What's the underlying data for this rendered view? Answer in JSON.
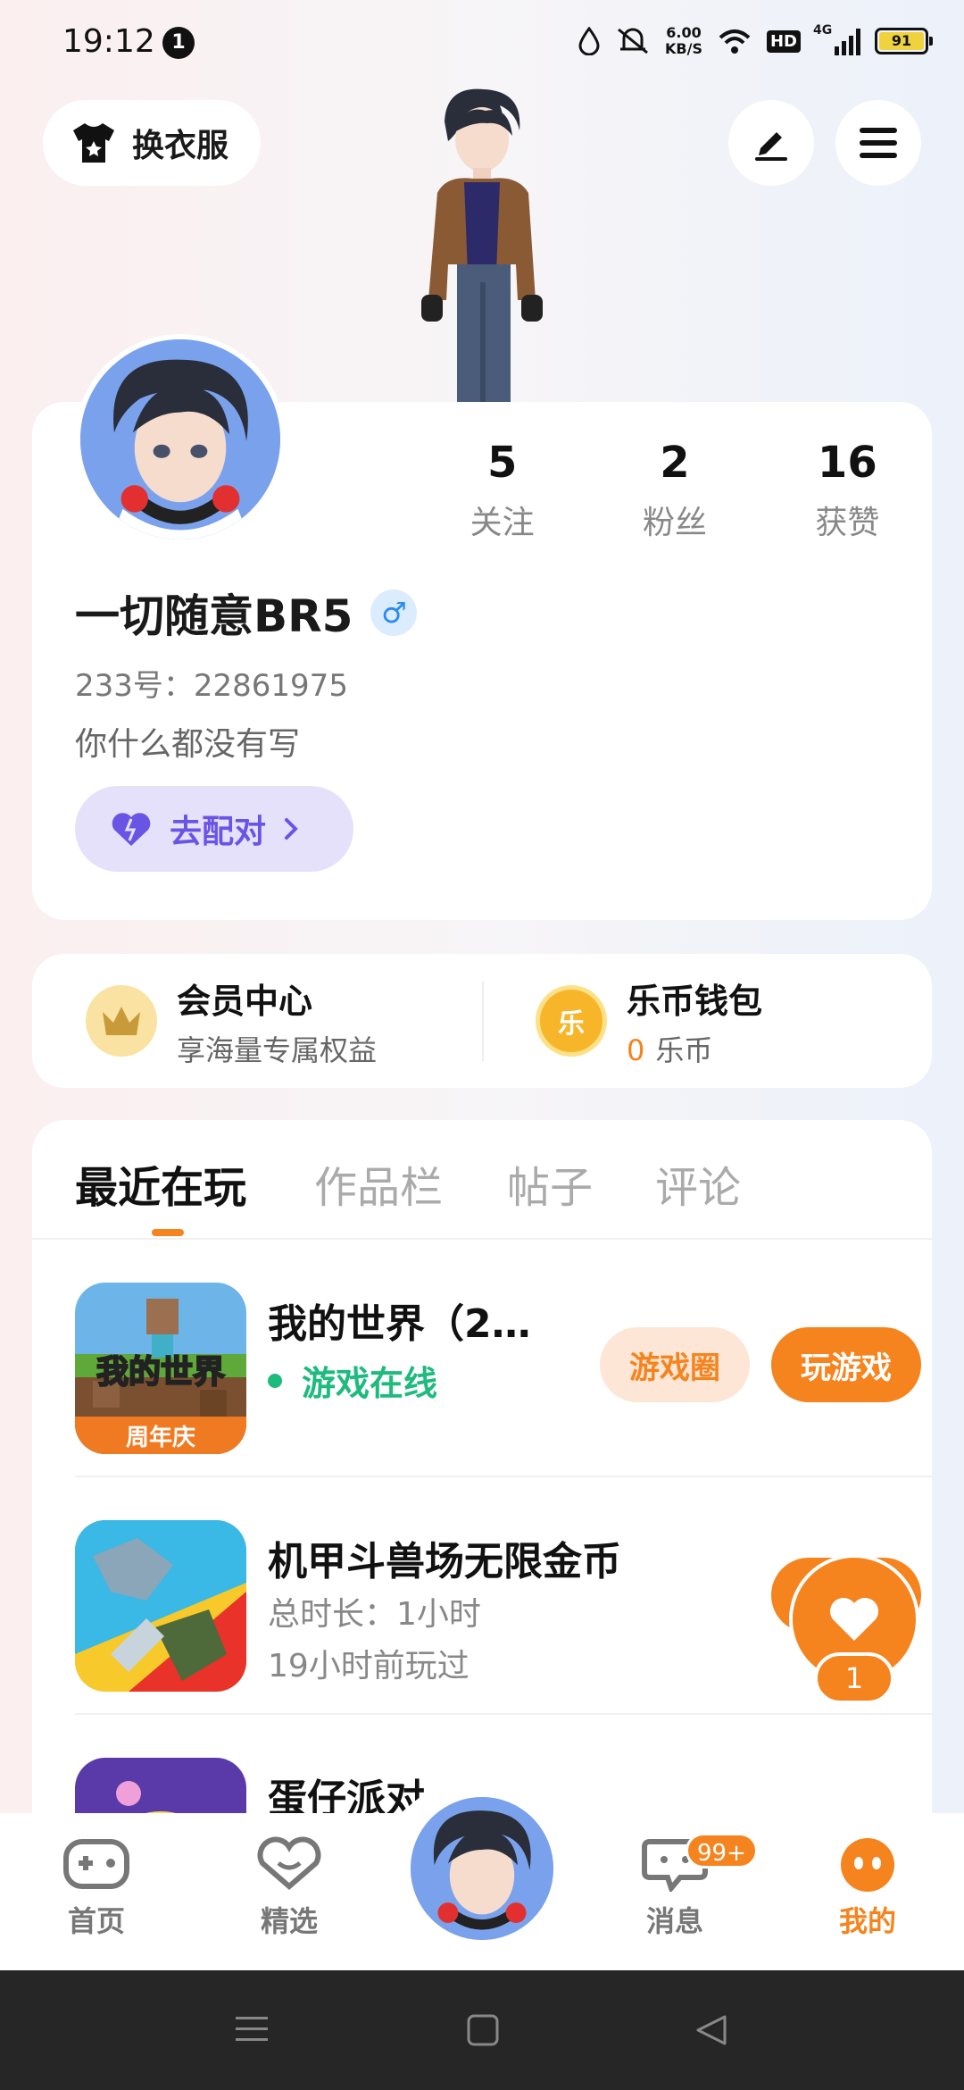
{
  "status_bar": {
    "time": "19:12",
    "notification_count": "1",
    "speed_value": "6.00",
    "speed_unit": "KB/S",
    "hd_label": "HD",
    "network_label": "4G",
    "battery": "91"
  },
  "header": {
    "outfit_label": "换衣服"
  },
  "profile": {
    "username": "一切随意BR5",
    "gender_symbol": "♂",
    "id_text": "233号：22861975",
    "bio": "你什么都没有写",
    "match_label": "去配对",
    "stats": [
      {
        "value": "5",
        "label": "关注"
      },
      {
        "value": "2",
        "label": "粉丝"
      },
      {
        "value": "16",
        "label": "获赞"
      }
    ]
  },
  "quick": {
    "vip_title": "会员中心",
    "vip_sub": "享海量专属权益",
    "wallet_title": "乐币钱包",
    "wallet_amount": "0",
    "wallet_unit": "乐币",
    "wallet_icon_char": "乐"
  },
  "tabs": [
    "最近在玩",
    "作品栏",
    "帖子",
    "评论"
  ],
  "games": [
    {
      "name": "我的世界（2…",
      "status": "游戏在线",
      "icon_text_top": "我的世界",
      "icon_text_bottom": "周年庆",
      "circle_label": "游戏圈",
      "play_label": "玩游戏"
    },
    {
      "name": "机甲斗兽场无限金币",
      "duration": "总时长：1小时",
      "last_played": "19小时前玩过",
      "play_label": "玩"
    },
    {
      "name": "蛋仔派对"
    }
  ],
  "floating": {
    "like_count": "1"
  },
  "bottom_nav": {
    "home": "首页",
    "featured": "精选",
    "messages": "消息",
    "messages_badge": "99+",
    "mine": "我的"
  },
  "colors": {
    "accent": "#f5841f",
    "online_green": "#1fba7e",
    "match_purple": "#6a54e6"
  }
}
